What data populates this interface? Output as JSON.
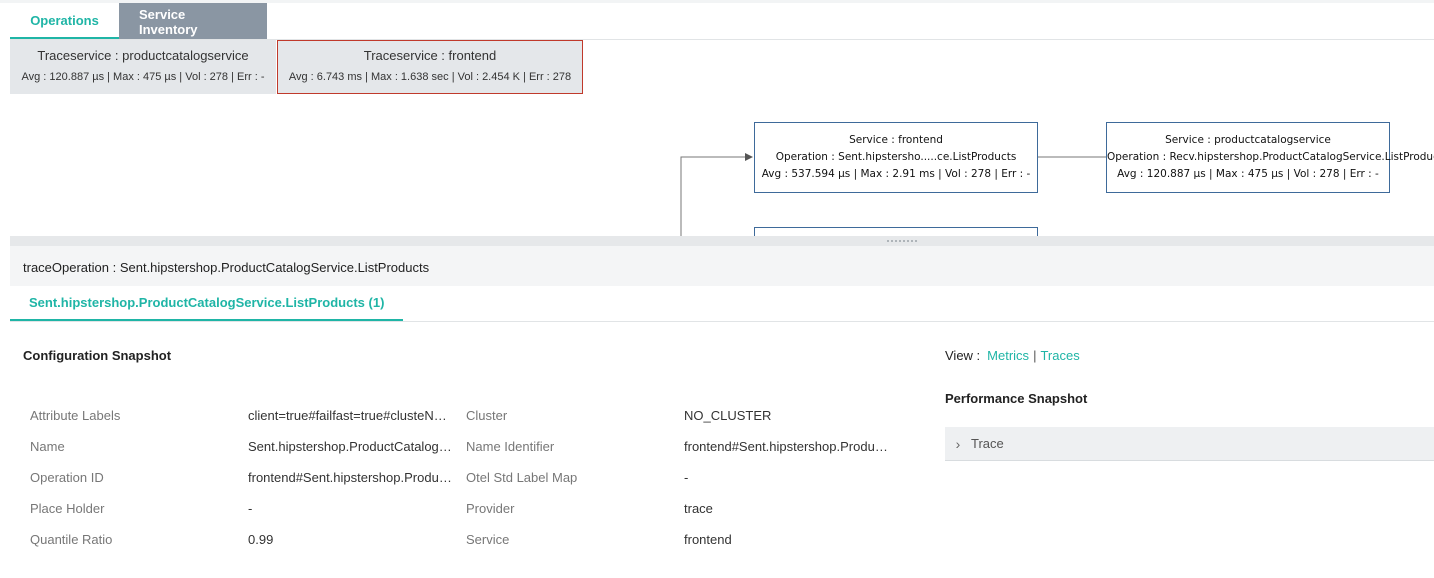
{
  "tabs": [
    {
      "label": "Operations"
    },
    {
      "label": "Service Inventory"
    }
  ],
  "trace_services": [
    {
      "title": "Traceservice : productcatalogservice",
      "metrics": "Avg : 120.887 µs | Max : 475 µs | Vol : 278 | Err : -"
    },
    {
      "title": "Traceservice : frontend",
      "metrics": "Avg : 6.743 ms | Max : 1.638 sec | Vol : 2.454 K | Err : 278"
    }
  ],
  "graph": {
    "nodes": [
      {
        "service": "Service : frontend",
        "operation": "Operation : Sent.hipstersho.....ce.ListProducts",
        "metrics": "Avg : 537.594 µs | Max : 2.91 ms | Vol : 278  | Err : -"
      },
      {
        "service": "Service : productcatalogservice",
        "operation": "Operation : Recv.hipstershop.ProductCatalogService.ListProducts",
        "metrics": "Avg : 120.887 µs | Max : 475 µs | Vol : 278  | Err : -"
      }
    ]
  },
  "detail": {
    "title": "traceOperation : Sent.hipstershop.ProductCatalogService.ListProducts",
    "subtab": "Sent.hipstershop.ProductCatalogService.ListProducts (1)"
  },
  "config": {
    "title": "Configuration Snapshot",
    "left": [
      {
        "label": "Attribute Labels",
        "value": "client=true#failfast=true#clusteName=NO_CLUSTER"
      },
      {
        "label": "Name",
        "value": "Sent.hipstershop.ProductCatalogService.ListProducts"
      },
      {
        "label": "Operation ID",
        "value": "frontend#Sent.hipstershop.ProductCatalogService.ListProducts"
      },
      {
        "label": "Place Holder",
        "value": "-"
      },
      {
        "label": "Quantile Ratio",
        "value": "0.99"
      }
    ],
    "right": [
      {
        "label": "Cluster",
        "value": "NO_CLUSTER"
      },
      {
        "label": "Name Identifier",
        "value": "frontend#Sent.hipstershop.ProductCatalogService.ListProducts"
      },
      {
        "label": "Otel Std Label Map",
        "value": "-"
      },
      {
        "label": "Provider",
        "value": "trace"
      },
      {
        "label": "Service",
        "value": "frontend"
      }
    ]
  },
  "view": {
    "label": "View :",
    "metrics": "Metrics",
    "separator": "|",
    "traces": "Traces"
  },
  "performance": {
    "title": "Performance Snapshot",
    "accordion_label": "Trace",
    "accordion_icon": "chevron-right-icon"
  },
  "colors": {
    "accent": "#1fb5a6",
    "inactive_tab": "#8a96a3",
    "node_border": "#3e6a9a",
    "selected_border": "#c0392b"
  }
}
